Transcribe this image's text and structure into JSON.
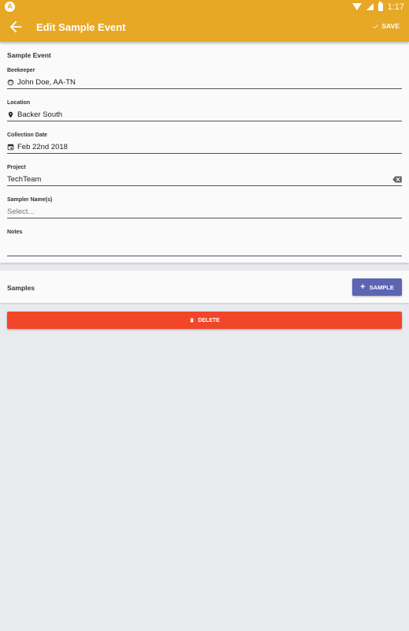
{
  "status_bar": {
    "app_badge": "A",
    "time": "1:17",
    "icons": [
      "wifi-icon",
      "signal-icon",
      "battery-icon"
    ]
  },
  "app_bar": {
    "title": "Edit Sample Event",
    "save_label": "SAVE",
    "back_icon": "arrow-back-icon",
    "save_icon": "check-icon"
  },
  "form": {
    "section_title": "Sample Event",
    "beekeeper": {
      "label": "Beekeeper",
      "value": "John Doe, AA-TN",
      "icon": "face-icon"
    },
    "location": {
      "label": "Location",
      "value": "Backer South",
      "icon": "location-pin-icon"
    },
    "collection_date": {
      "label": "Collection Date",
      "value": "Feb 22nd 2018",
      "icon": "calendar-icon"
    },
    "project": {
      "label": "Project",
      "value": "TechTeam",
      "icon": "clear-icon"
    },
    "sampler_names": {
      "label": "Sampler Name(s)",
      "placeholder": "Select..."
    },
    "notes": {
      "label": "Notes",
      "value": ""
    }
  },
  "samples": {
    "title": "Samples",
    "add_button_label": "SAMPLE"
  },
  "delete": {
    "label": "DELETE",
    "icon": "trash-icon"
  },
  "colors": {
    "primary": "#e7a826",
    "accent": "#5c65b2",
    "danger": "#f2462a",
    "background": "#e8eaed"
  }
}
